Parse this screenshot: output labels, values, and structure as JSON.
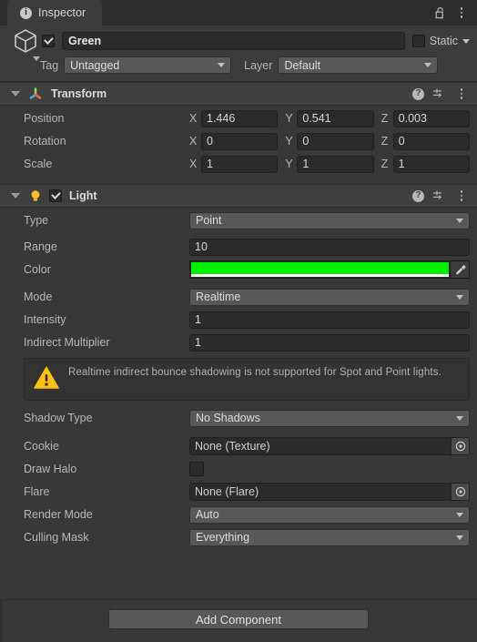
{
  "window": {
    "tab_label": "Inspector",
    "tab_icon": "info-icon",
    "lock_icon": "padlock-unlocked-icon",
    "menu_icon": "kebab-menu-icon"
  },
  "gameobject": {
    "icon": "cube-icon",
    "enabled": true,
    "name": "Green",
    "static_label": "Static",
    "static_checked": false,
    "tag_label": "Tag",
    "tag_value": "Untagged",
    "layer_label": "Layer",
    "layer_value": "Default"
  },
  "components": [
    {
      "title": "Transform",
      "icon": "transform-gizmo-icon",
      "expanded": true,
      "has_enable_toggle": false,
      "help_icon": "help-icon",
      "preset_icon": "preset-sliders-icon",
      "menu_icon": "kebab-menu-icon",
      "vectors": [
        {
          "label": "Position",
          "x": "1.446",
          "y": "0.541",
          "z": "0.003"
        },
        {
          "label": "Rotation",
          "x": "0",
          "y": "0",
          "z": "0"
        },
        {
          "label": "Scale",
          "x": "1",
          "y": "1",
          "z": "1"
        }
      ],
      "axis_labels": [
        "X",
        "Y",
        "Z"
      ]
    },
    {
      "title": "Light",
      "icon": "lightbulb-icon",
      "expanded": true,
      "has_enable_toggle": true,
      "enabled": true,
      "help_icon": "help-icon",
      "preset_icon": "preset-sliders-icon",
      "menu_icon": "kebab-menu-icon",
      "fields": {
        "type": {
          "label": "Type",
          "value": "Point"
        },
        "range": {
          "label": "Range",
          "value": "10"
        },
        "color": {
          "label": "Color",
          "value": "#00F000",
          "alpha_color": "#FFFFFF"
        },
        "mode": {
          "label": "Mode",
          "value": "Realtime"
        },
        "intensity": {
          "label": "Intensity",
          "value": "1"
        },
        "indirect_multiplier": {
          "label": "Indirect Multiplier",
          "value": "1"
        },
        "warning": {
          "icon": "warning-triangle-icon",
          "color": "#FFC114",
          "text": "Realtime indirect bounce shadowing is not supported for Spot and Point lights."
        },
        "shadow_type": {
          "label": "Shadow Type",
          "value": "No Shadows"
        },
        "cookie": {
          "label": "Cookie",
          "value": "None (Texture)",
          "picker_icon": "object-picker-icon"
        },
        "draw_halo": {
          "label": "Draw Halo",
          "checked": false
        },
        "flare": {
          "label": "Flare",
          "value": "None (Flare)",
          "picker_icon": "object-picker-icon"
        },
        "render_mode": {
          "label": "Render Mode",
          "value": "Auto"
        },
        "culling_mask": {
          "label": "Culling Mask",
          "value": "Everything"
        }
      }
    }
  ],
  "footer": {
    "add_component_label": "Add Component"
  }
}
